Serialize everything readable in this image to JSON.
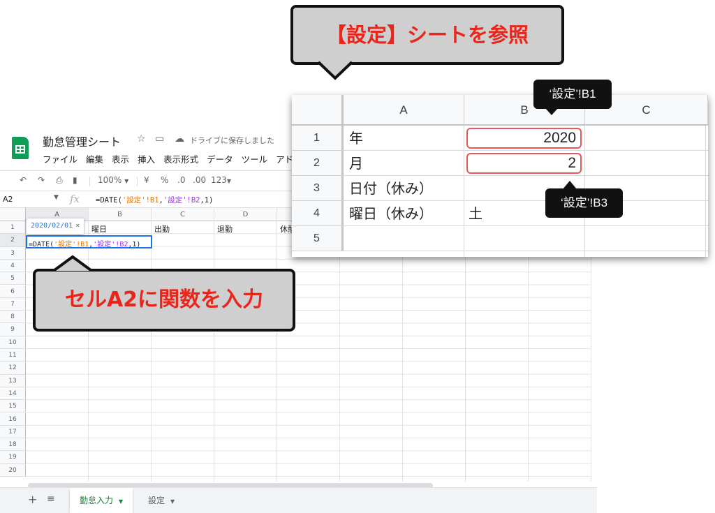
{
  "document": {
    "title": "勤怠管理シート",
    "save_status": "ドライブに保存しました"
  },
  "menubar": [
    "ファイル",
    "編集",
    "表示",
    "挿入",
    "表示形式",
    "データ",
    "ツール",
    "アド"
  ],
  "toolbar": {
    "zoom": "100%",
    "currency": "¥",
    "percent": "%",
    "decrease_decimals": ".0",
    "increase_decimals": ".00",
    "more_formats": "123"
  },
  "formula_bar": {
    "cell_ref": "A2",
    "fx": "fx",
    "formula": "=DATE('設定'!B1,'設定'!B2,1)",
    "parts": [
      "=DATE(",
      "'設定'!B1",
      ",",
      "'設定'!B2",
      ",1)"
    ]
  },
  "grid": {
    "columns": [
      "A",
      "B",
      "C",
      "D"
    ],
    "rows": [
      "1",
      "2",
      "3",
      "4",
      "5",
      "6",
      "7",
      "8",
      "9",
      "10",
      "11",
      "12",
      "13",
      "14",
      "15",
      "16",
      "17",
      "18",
      "19",
      "20"
    ],
    "row1_cells": [
      "曜日",
      "出勤",
      "退勤",
      "休憩"
    ],
    "active_cell_formula_parts": [
      "=DATE(",
      "'設定'!B1",
      ",",
      "'設定'!B2",
      ",1)"
    ],
    "hint_value": "2020/02/01",
    "hint_close": "×"
  },
  "sheet_tabs": [
    {
      "label": "勤怠入力",
      "active": true
    },
    {
      "label": "設定",
      "active": false
    }
  ],
  "settings_zoom": {
    "columns": [
      "A",
      "B",
      "C"
    ],
    "rows": [
      "1",
      "2",
      "3",
      "4",
      "5"
    ],
    "labels": [
      "年",
      "月",
      "日付（休み）",
      "曜日（休み）"
    ],
    "b1": "2020",
    "b2": "2",
    "b4": "土"
  },
  "callouts": {
    "top": "【設定】シートを参照",
    "bottom": "セルA2に関数を入力",
    "tag_b1": "‘設定’!B1",
    "tag_b3": "‘設定’!B3"
  },
  "colors": {
    "sheets_green": "#0f9d58",
    "active_blue": "#1a73e8",
    "ref_orange": "#e37400",
    "ref_purple": "#9334e6",
    "callout_red": "#e8261c",
    "callout_gray": "#cfcfcf",
    "highlight_border": "#e8575a"
  }
}
